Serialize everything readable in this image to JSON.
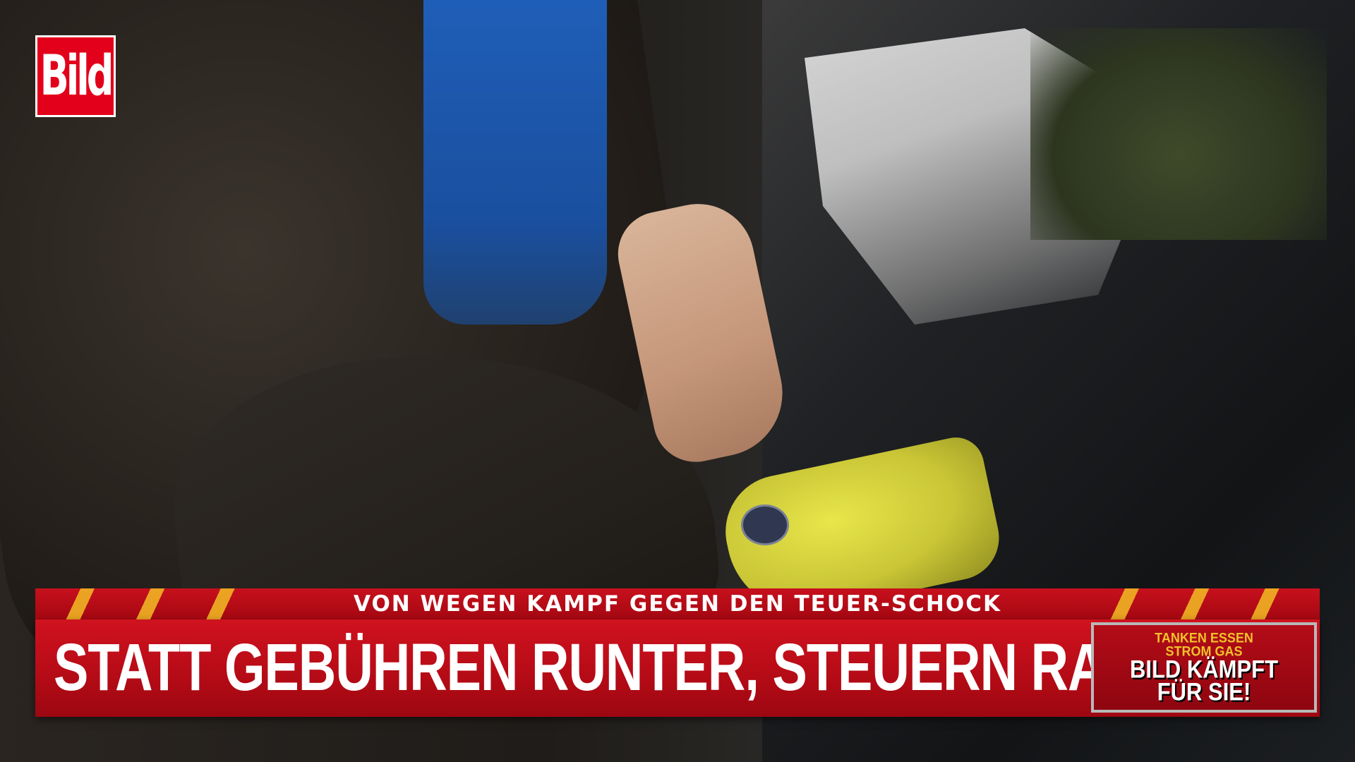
{
  "logo": {
    "text": "Bild",
    "color": "#e2001a"
  },
  "lower_third": {
    "kicker": "VON WEGEN KAMPF GEGEN DEN TEUER-SCHOCK",
    "headline": "STATT GEBÜHREN RUNTER, STEUERN RAUF!",
    "badge": {
      "line1": "TANKEN ESSEN",
      "line2": "STROM GAS",
      "line3": "BILD KÄMPFT",
      "line4": "FÜR SIE!"
    },
    "colors": {
      "red": "#c7101d",
      "stripe": "#f0b323",
      "badge_text_accent": "#f2c12a"
    }
  }
}
